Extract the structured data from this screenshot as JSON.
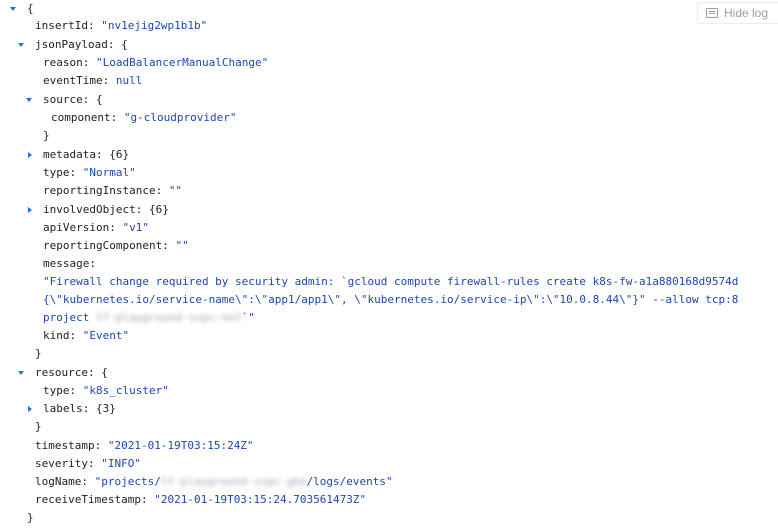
{
  "hide_log_button": {
    "label": "Hide log",
    "icon": "log-icon"
  },
  "log": {
    "open_brace": "{",
    "insertId": {
      "key": "insertId",
      "value": "\"nv1ejig2wp1b1b\""
    },
    "jsonPayload": {
      "key": "jsonPayload",
      "reason": {
        "key": "reason",
        "value": "\"LoadBalancerManualChange\""
      },
      "eventTime": {
        "key": "eventTime",
        "value": "null"
      },
      "source": {
        "key": "source",
        "component_key": "component",
        "component_value": "\"g-cloudprovider\""
      },
      "metadata": {
        "key": "metadata",
        "summary": "{6}"
      },
      "type": {
        "key": "type",
        "value": "\"Normal\""
      },
      "reportingInstance": {
        "key": "reportingInstance",
        "value": "\"\""
      },
      "involvedObject": {
        "key": "involvedObject",
        "summary": "{6}"
      },
      "apiVersion": {
        "key": "apiVersion",
        "value": "\"v1\""
      },
      "reportingComponent": {
        "key": "reportingComponent",
        "value": "\"\""
      },
      "message": {
        "key": "message",
        "line1": "\"Firewall change required by security admin: `gcloud compute firewall-rules create k8s-fw-a1a880168d9574d",
        "line2": "{\\\"kubernetes.io/service-name\\\":\\\"app1/app1\\\", \\\"kubernetes.io/service-ip\\\":\\\"10.0.8.44\\\"}\" --allow tcp:8",
        "line3_prefix": "project ",
        "line3_redacted": "tf-playground-svpc-net",
        "line3_suffix": "`\""
      },
      "kind": {
        "key": "kind",
        "value": "\"Event\""
      }
    },
    "resource": {
      "key": "resource",
      "type": {
        "key": "type",
        "value": "\"k8s_cluster\""
      },
      "labels": {
        "key": "labels",
        "summary": "{3}"
      }
    },
    "timestamp": {
      "key": "timestamp",
      "value": "\"2021-01-19T03:15:24Z\""
    },
    "severity": {
      "key": "severity",
      "value": "\"INFO\""
    },
    "logName": {
      "key": "logName",
      "prefix": "\"projects/",
      "redacted": "tf-playground-svpc-gke",
      "suffix": "/logs/events\""
    },
    "receiveTimestamp": {
      "key": "receiveTimestamp",
      "value": "\"2021-01-19T03:15:24.703561473Z\""
    },
    "close_brace": "}"
  }
}
